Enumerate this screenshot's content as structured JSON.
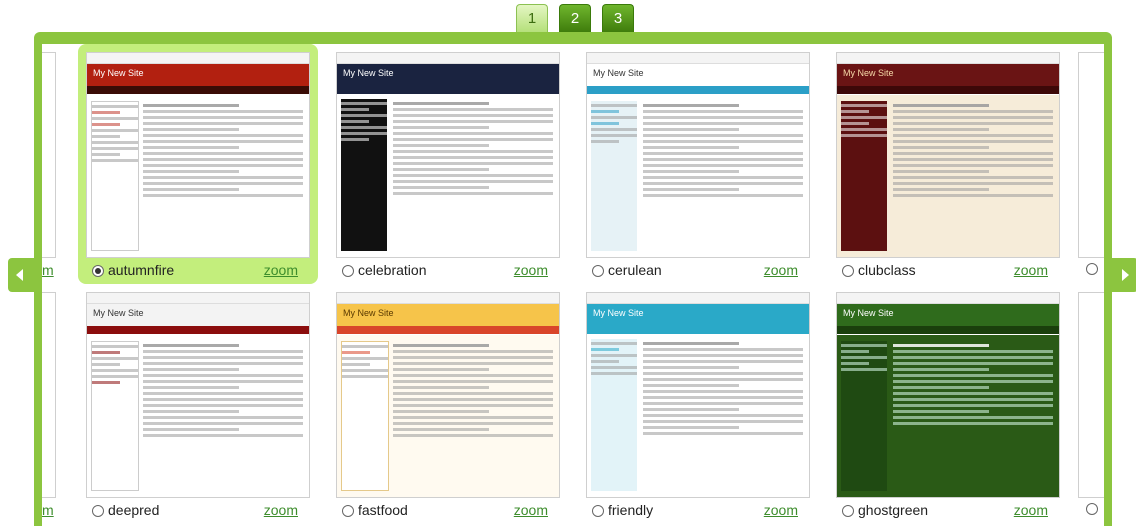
{
  "pages": [
    "1",
    "2",
    "3"
  ],
  "active_page": "1",
  "thumbnail_site_title": "My New Site",
  "zoom_label": "zoom",
  "edge_zoom_fragment": "m",
  "themes": [
    {
      "name": "autumnfire",
      "selected": true,
      "header": "#b22010",
      "side": "#ffffff"
    },
    {
      "name": "celebration",
      "selected": false,
      "header": "#1a2340",
      "side": "#111111"
    },
    {
      "name": "cerulean",
      "selected": false,
      "header": "#ffffff",
      "side": "#e6f2f6"
    },
    {
      "name": "clubclass",
      "selected": false,
      "header": "#6a1414",
      "side": "#5c1010"
    },
    {
      "name": "deepred",
      "selected": false,
      "header": "#f3f3f3",
      "side": "#ffffff"
    },
    {
      "name": "fastfood",
      "selected": false,
      "header": "#f6c44a",
      "side": "#ffffff"
    },
    {
      "name": "friendly",
      "selected": false,
      "header": "#2aa9c8",
      "side": "#e2f3f8"
    },
    {
      "name": "ghostgreen",
      "selected": false,
      "header": "#2f6b1c",
      "side": "#1f4a12"
    }
  ],
  "colors": {
    "frame": "#8cc53f",
    "selected_bg": "#c3ee7c",
    "tab_active": "#b5e07a",
    "zoom_link": "#3d8d2c"
  }
}
